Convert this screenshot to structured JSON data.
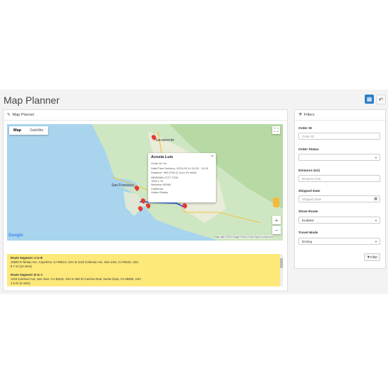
{
  "page": {
    "title": "Map Planner"
  },
  "header_buttons": {
    "primary_icon": "grid-icon",
    "back_icon": "reply-icon"
  },
  "map_panel": {
    "title": "Map Planner",
    "map_type": {
      "map_label": "Map",
      "satellite_label": "Satellite"
    },
    "zoom_in": "+",
    "zoom_out": "−",
    "google_logo": "Google",
    "attribution": "Map data ©2020 Google   Terms of Use   Report a map error",
    "cities": [
      "Sacramento",
      "San Francisco"
    ],
    "info_window": {
      "name": "Acosta Luis",
      "order_id": "Order ID: 9e",
      "delivery": "Date/Time Delivery: 2020-09-14 10:00 - 11:00",
      "distance": "Distance: 953.27mi (1 hour 39 mins)",
      "address": [
        "NEWMAN CITY TOW",
        "1500 L St",
        "Newman 95360",
        "California",
        "United States"
      ]
    }
  },
  "route_segments": [
    {
      "title": "Route Segment: A to B",
      "address": "10600 N Tantau Ave, Cupertino, CA 95014, USA to 1123 Coleman Ave, San Jose, CA 95110, USA",
      "distance": "8.7 mi (14 mins)"
    },
    {
      "title": "Route Segment: B to C",
      "address": "1123 Coleman Ave, San Jose, CA 95110, USA to 500 El Camino Real, Santa Clara, CA 95050, USA",
      "distance": "1.5 mi (4 mins)"
    }
  ],
  "filters": {
    "title": "Filters",
    "order_id": {
      "label": "Order ID",
      "placeholder": "Order ID"
    },
    "order_status": {
      "label": "Order Status",
      "value": ""
    },
    "distance": {
      "label": "Distance (mi)",
      "placeholder": "Distance (mi)"
    },
    "shipped_date": {
      "label": "Shipped Date",
      "placeholder": "Shipped Date"
    },
    "show_route": {
      "label": "Show Route",
      "value": "Enabled"
    },
    "travel_mode": {
      "label": "Travel Mode",
      "value": "Driving"
    },
    "filter_button": "Filter"
  }
}
